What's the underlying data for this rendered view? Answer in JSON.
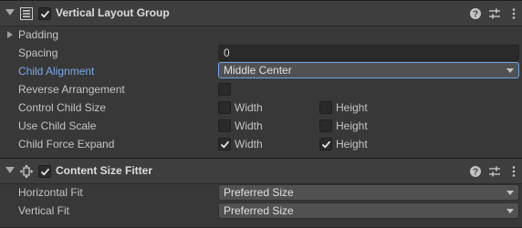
{
  "layout_group": {
    "title": "Vertical Layout Group",
    "enabled": true,
    "icon": "vertical-layout-icon",
    "padding_label": "Padding",
    "spacing_label": "Spacing",
    "spacing_value": "0",
    "child_alignment_label": "Child Alignment",
    "child_alignment_value": "Middle Center",
    "reverse_label": "Reverse Arrangement",
    "reverse_checked": false,
    "control_size_label": "Control Child Size",
    "use_scale_label": "Use Child Scale",
    "force_expand_label": "Child Force Expand",
    "width_label": "Width",
    "height_label": "Height",
    "control_size": {
      "width": false,
      "height": false
    },
    "use_scale": {
      "width": false,
      "height": false
    },
    "force_expand": {
      "width": true,
      "height": true
    }
  },
  "size_fitter": {
    "title": "Content Size Fitter",
    "enabled": true,
    "icon": "content-size-fitter-icon",
    "horizontal_label": "Horizontal Fit",
    "horizontal_value": "Preferred Size",
    "vertical_label": "Vertical Fit",
    "vertical_value": "Preferred Size"
  },
  "header_buttons": [
    "help-icon",
    "preset-icon",
    "context-menu-icon"
  ]
}
